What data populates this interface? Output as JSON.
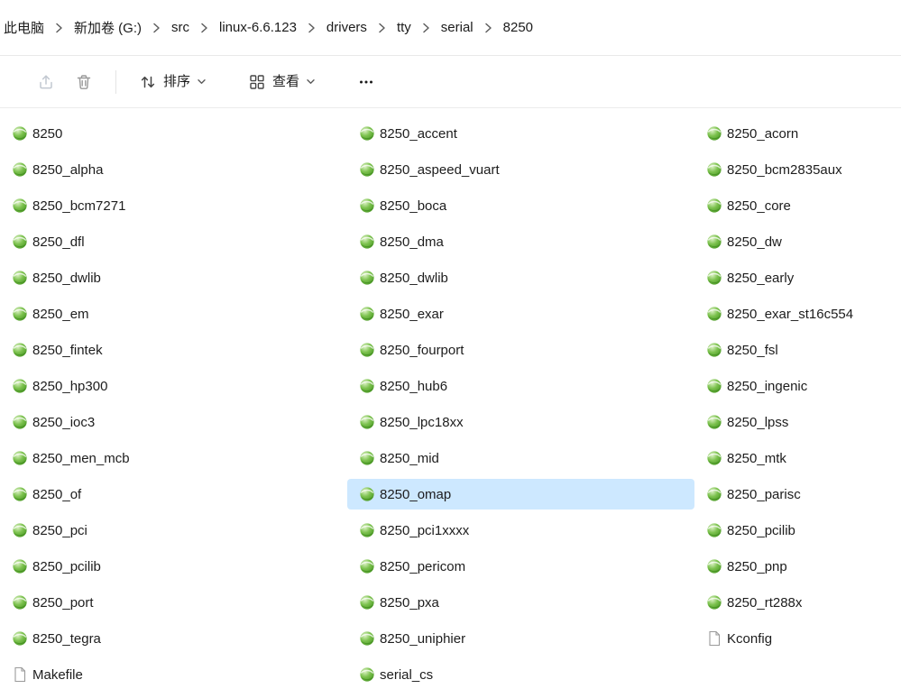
{
  "breadcrumb": {
    "items": [
      "此电脑",
      "新加卷 (G:)",
      "src",
      "linux-6.6.123",
      "drivers",
      "tty",
      "serial",
      "8250"
    ]
  },
  "toolbar": {
    "sort_label": "排序",
    "view_label": "查看"
  },
  "selection": {
    "color": "#cde8ff",
    "selected_file": "8250_omap"
  },
  "files": [
    {
      "name": "8250",
      "icon": "source-file-icon"
    },
    {
      "name": "8250_accent",
      "icon": "source-file-icon"
    },
    {
      "name": "8250_acorn",
      "icon": "source-file-icon"
    },
    {
      "name": "8250_alpha",
      "icon": "source-file-icon"
    },
    {
      "name": "8250_aspeed_vuart",
      "icon": "source-file-icon"
    },
    {
      "name": "8250_bcm2835aux",
      "icon": "source-file-icon"
    },
    {
      "name": "8250_bcm7271",
      "icon": "source-file-icon"
    },
    {
      "name": "8250_boca",
      "icon": "source-file-icon"
    },
    {
      "name": "8250_core",
      "icon": "source-file-icon"
    },
    {
      "name": "8250_dfl",
      "icon": "source-file-icon"
    },
    {
      "name": "8250_dma",
      "icon": "source-file-icon"
    },
    {
      "name": "8250_dw",
      "icon": "source-file-icon"
    },
    {
      "name": "8250_dwlib",
      "icon": "source-file-icon"
    },
    {
      "name": "8250_dwlib",
      "icon": "source-file-icon"
    },
    {
      "name": "8250_early",
      "icon": "source-file-icon"
    },
    {
      "name": "8250_em",
      "icon": "source-file-icon"
    },
    {
      "name": "8250_exar",
      "icon": "source-file-icon"
    },
    {
      "name": "8250_exar_st16c554",
      "icon": "source-file-icon"
    },
    {
      "name": "8250_fintek",
      "icon": "source-file-icon"
    },
    {
      "name": "8250_fourport",
      "icon": "source-file-icon"
    },
    {
      "name": "8250_fsl",
      "icon": "source-file-icon"
    },
    {
      "name": "8250_hp300",
      "icon": "source-file-icon"
    },
    {
      "name": "8250_hub6",
      "icon": "source-file-icon"
    },
    {
      "name": "8250_ingenic",
      "icon": "source-file-icon"
    },
    {
      "name": "8250_ioc3",
      "icon": "source-file-icon"
    },
    {
      "name": "8250_lpc18xx",
      "icon": "source-file-icon"
    },
    {
      "name": "8250_lpss",
      "icon": "source-file-icon"
    },
    {
      "name": "8250_men_mcb",
      "icon": "source-file-icon"
    },
    {
      "name": "8250_mid",
      "icon": "source-file-icon"
    },
    {
      "name": "8250_mtk",
      "icon": "source-file-icon"
    },
    {
      "name": "8250_of",
      "icon": "source-file-icon"
    },
    {
      "name": "8250_omap",
      "icon": "source-file-icon",
      "selected": true
    },
    {
      "name": "8250_parisc",
      "icon": "source-file-icon"
    },
    {
      "name": "8250_pci",
      "icon": "source-file-icon"
    },
    {
      "name": "8250_pci1xxxx",
      "icon": "source-file-icon"
    },
    {
      "name": "8250_pcilib",
      "icon": "source-file-icon"
    },
    {
      "name": "8250_pcilib",
      "icon": "source-file-icon"
    },
    {
      "name": "8250_pericom",
      "icon": "source-file-icon"
    },
    {
      "name": "8250_pnp",
      "icon": "source-file-icon"
    },
    {
      "name": "8250_port",
      "icon": "source-file-icon"
    },
    {
      "name": "8250_pxa",
      "icon": "source-file-icon"
    },
    {
      "name": "8250_rt288x",
      "icon": "source-file-icon"
    },
    {
      "name": "8250_tegra",
      "icon": "source-file-icon"
    },
    {
      "name": "8250_uniphier",
      "icon": "source-file-icon"
    },
    {
      "name": "Kconfig",
      "icon": "document-icon"
    },
    {
      "name": "Makefile",
      "icon": "document-icon"
    },
    {
      "name": "serial_cs",
      "icon": "source-file-icon"
    }
  ]
}
